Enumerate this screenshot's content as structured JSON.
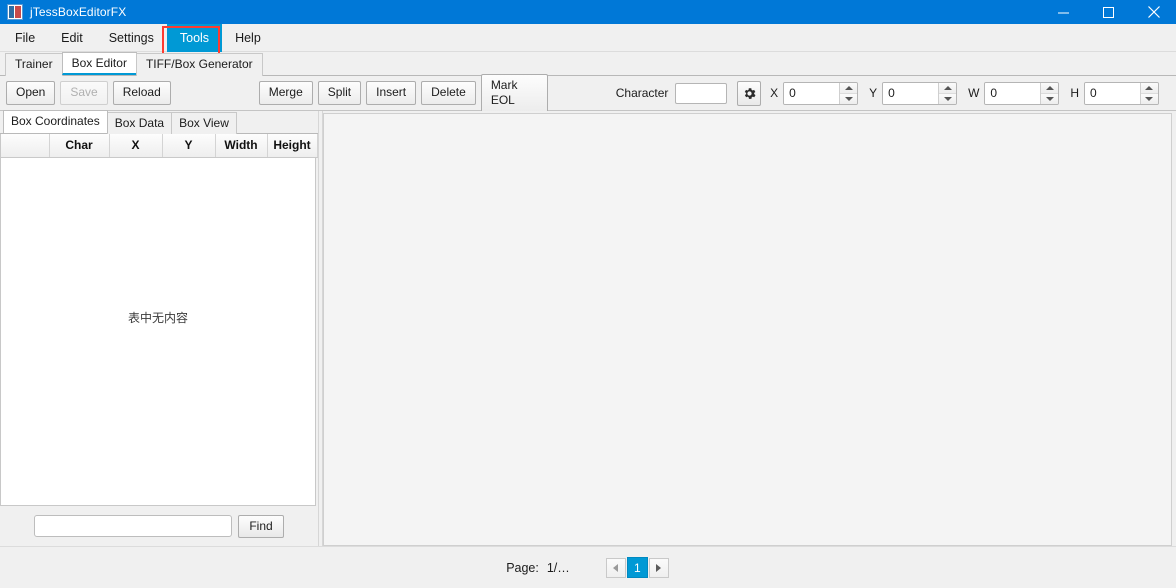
{
  "window": {
    "title": "jTessBoxEditorFX",
    "icon": "app-image-icon",
    "controls": {
      "minimize": "minimize-icon",
      "maximize": "maximize-icon",
      "close": "close-icon"
    },
    "titlebar_color": "#0078d7"
  },
  "menubar": {
    "items": [
      {
        "label": "File",
        "active": false
      },
      {
        "label": "Edit",
        "active": false
      },
      {
        "label": "Settings",
        "active": false
      },
      {
        "label": "Tools",
        "active": true
      },
      {
        "label": "Help",
        "active": false
      }
    ],
    "highlight_color": "#0099d5",
    "annotation_color": "#ff3b30"
  },
  "main_tabs": {
    "items": [
      {
        "label": "Trainer",
        "selected": false
      },
      {
        "label": "Box Editor",
        "selected": true
      },
      {
        "label": "TIFF/Box Generator",
        "selected": false
      }
    ]
  },
  "toolbar": {
    "open_label": "Open",
    "save_label": "Save",
    "save_disabled": true,
    "reload_label": "Reload",
    "merge_label": "Merge",
    "split_label": "Split",
    "insert_label": "Insert",
    "delete_label": "Delete",
    "mark_eol_label": "Mark EOL",
    "character_label": "Character",
    "character_value": "",
    "gear_icon": "gear-icon",
    "fields": [
      {
        "label": "X",
        "value": "0"
      },
      {
        "label": "Y",
        "value": "0"
      },
      {
        "label": "W",
        "value": "0"
      },
      {
        "label": "H",
        "value": "0"
      }
    ]
  },
  "left_panel": {
    "tabs": [
      {
        "label": "Box Coordinates",
        "selected": true
      },
      {
        "label": "Box Data",
        "selected": false
      },
      {
        "label": "Box View",
        "selected": false
      }
    ],
    "table": {
      "columns": [
        "",
        "Char",
        "X",
        "Y",
        "Width",
        "Height"
      ],
      "rows": [],
      "empty_message": "表中无内容"
    },
    "find": {
      "value": "",
      "button_label": "Find"
    }
  },
  "status": {
    "page_label": "Page:",
    "page_value": "1/…",
    "prev_icon": "chevron-left-icon",
    "next_icon": "chevron-right-icon",
    "current_page": "1",
    "current_page_color": "#0099d5"
  }
}
